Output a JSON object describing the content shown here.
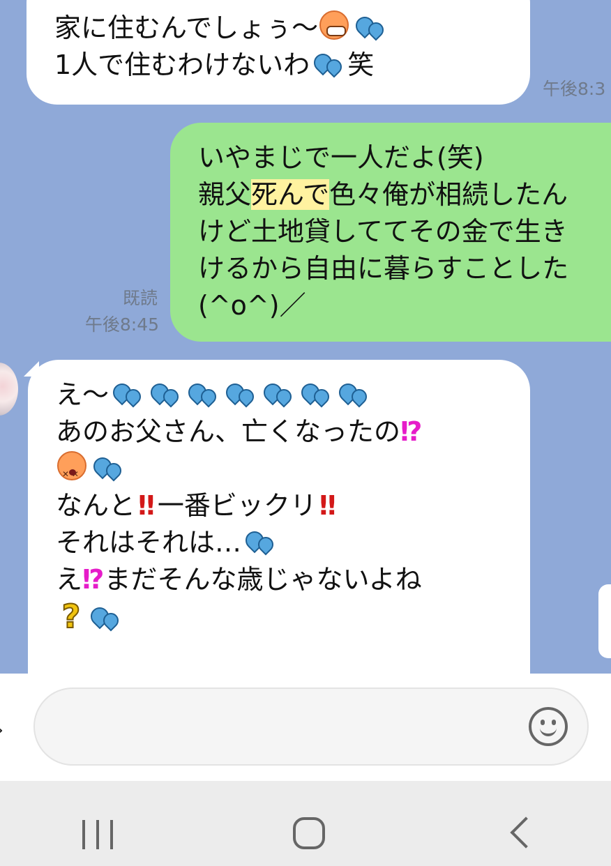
{
  "messages": [
    {
      "side": "in",
      "lines": [
        "家に住むんでしょぅ〜",
        "1人で住むわけないわ",
        "笑"
      ],
      "time": "午後8:3"
    },
    {
      "side": "out",
      "lines": [
        "いやまじで一人だよ(笑)",
        "親父",
        "死んで",
        "色々俺が相続したん",
        "けど土地貸しててその金で生き",
        "けるから自由に暮らすことした",
        "(^o^)／"
      ],
      "read": "既読",
      "time": "午後8:45"
    },
    {
      "side": "in",
      "lines": [
        "え〜",
        "あのお父さん、亡くなったの",
        "⁉",
        "なんと",
        "‼",
        "一番ビックリ",
        "‼",
        "それはそれは…",
        "え",
        "⁉",
        "まだそんな歳じゃないよね",
        "?"
      ]
    }
  ],
  "input": {
    "placeholder": ""
  },
  "icons": {
    "emoji_button": "smiley-icon",
    "sweat_drops": "sweat-drops-icon",
    "grinning_face": "grinning-face-icon",
    "dizzy_face": "dizzy-face-icon",
    "nav_recents": "recents-icon",
    "nav_home": "home-icon",
    "nav_back": "back-icon"
  },
  "colors": {
    "chat_background": "#8fa9d8",
    "incoming_bubble": "#ffffff",
    "outgoing_bubble": "#9be58f",
    "highlight": "#fff2a0"
  }
}
